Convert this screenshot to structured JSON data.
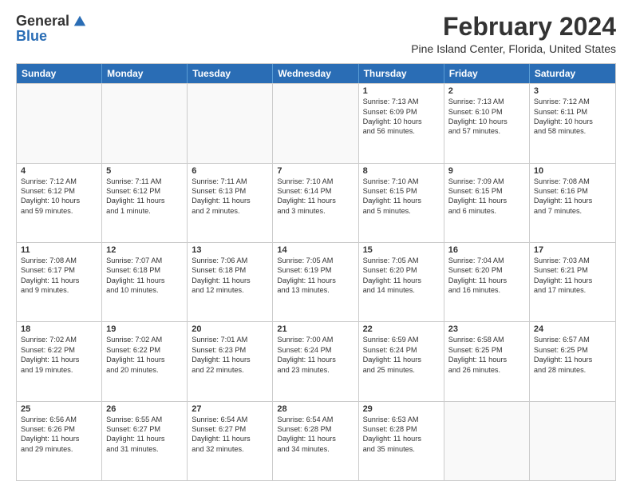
{
  "header": {
    "logo_general": "General",
    "logo_blue": "Blue",
    "month_title": "February 2024",
    "location": "Pine Island Center, Florida, United States"
  },
  "days_of_week": [
    "Sunday",
    "Monday",
    "Tuesday",
    "Wednesday",
    "Thursday",
    "Friday",
    "Saturday"
  ],
  "weeks": [
    [
      {
        "day": "",
        "empty": true
      },
      {
        "day": "",
        "empty": true
      },
      {
        "day": "",
        "empty": true
      },
      {
        "day": "",
        "empty": true
      },
      {
        "day": "1",
        "lines": [
          "Sunrise: 7:13 AM",
          "Sunset: 6:09 PM",
          "Daylight: 10 hours",
          "and 56 minutes."
        ]
      },
      {
        "day": "2",
        "lines": [
          "Sunrise: 7:13 AM",
          "Sunset: 6:10 PM",
          "Daylight: 10 hours",
          "and 57 minutes."
        ]
      },
      {
        "day": "3",
        "lines": [
          "Sunrise: 7:12 AM",
          "Sunset: 6:11 PM",
          "Daylight: 10 hours",
          "and 58 minutes."
        ]
      }
    ],
    [
      {
        "day": "4",
        "lines": [
          "Sunrise: 7:12 AM",
          "Sunset: 6:12 PM",
          "Daylight: 10 hours",
          "and 59 minutes."
        ]
      },
      {
        "day": "5",
        "lines": [
          "Sunrise: 7:11 AM",
          "Sunset: 6:12 PM",
          "Daylight: 11 hours",
          "and 1 minute."
        ]
      },
      {
        "day": "6",
        "lines": [
          "Sunrise: 7:11 AM",
          "Sunset: 6:13 PM",
          "Daylight: 11 hours",
          "and 2 minutes."
        ]
      },
      {
        "day": "7",
        "lines": [
          "Sunrise: 7:10 AM",
          "Sunset: 6:14 PM",
          "Daylight: 11 hours",
          "and 3 minutes."
        ]
      },
      {
        "day": "8",
        "lines": [
          "Sunrise: 7:10 AM",
          "Sunset: 6:15 PM",
          "Daylight: 11 hours",
          "and 5 minutes."
        ]
      },
      {
        "day": "9",
        "lines": [
          "Sunrise: 7:09 AM",
          "Sunset: 6:15 PM",
          "Daylight: 11 hours",
          "and 6 minutes."
        ]
      },
      {
        "day": "10",
        "lines": [
          "Sunrise: 7:08 AM",
          "Sunset: 6:16 PM",
          "Daylight: 11 hours",
          "and 7 minutes."
        ]
      }
    ],
    [
      {
        "day": "11",
        "lines": [
          "Sunrise: 7:08 AM",
          "Sunset: 6:17 PM",
          "Daylight: 11 hours",
          "and 9 minutes."
        ]
      },
      {
        "day": "12",
        "lines": [
          "Sunrise: 7:07 AM",
          "Sunset: 6:18 PM",
          "Daylight: 11 hours",
          "and 10 minutes."
        ]
      },
      {
        "day": "13",
        "lines": [
          "Sunrise: 7:06 AM",
          "Sunset: 6:18 PM",
          "Daylight: 11 hours",
          "and 12 minutes."
        ]
      },
      {
        "day": "14",
        "lines": [
          "Sunrise: 7:05 AM",
          "Sunset: 6:19 PM",
          "Daylight: 11 hours",
          "and 13 minutes."
        ]
      },
      {
        "day": "15",
        "lines": [
          "Sunrise: 7:05 AM",
          "Sunset: 6:20 PM",
          "Daylight: 11 hours",
          "and 14 minutes."
        ]
      },
      {
        "day": "16",
        "lines": [
          "Sunrise: 7:04 AM",
          "Sunset: 6:20 PM",
          "Daylight: 11 hours",
          "and 16 minutes."
        ]
      },
      {
        "day": "17",
        "lines": [
          "Sunrise: 7:03 AM",
          "Sunset: 6:21 PM",
          "Daylight: 11 hours",
          "and 17 minutes."
        ]
      }
    ],
    [
      {
        "day": "18",
        "lines": [
          "Sunrise: 7:02 AM",
          "Sunset: 6:22 PM",
          "Daylight: 11 hours",
          "and 19 minutes."
        ]
      },
      {
        "day": "19",
        "lines": [
          "Sunrise: 7:02 AM",
          "Sunset: 6:22 PM",
          "Daylight: 11 hours",
          "and 20 minutes."
        ]
      },
      {
        "day": "20",
        "lines": [
          "Sunrise: 7:01 AM",
          "Sunset: 6:23 PM",
          "Daylight: 11 hours",
          "and 22 minutes."
        ]
      },
      {
        "day": "21",
        "lines": [
          "Sunrise: 7:00 AM",
          "Sunset: 6:24 PM",
          "Daylight: 11 hours",
          "and 23 minutes."
        ]
      },
      {
        "day": "22",
        "lines": [
          "Sunrise: 6:59 AM",
          "Sunset: 6:24 PM",
          "Daylight: 11 hours",
          "and 25 minutes."
        ]
      },
      {
        "day": "23",
        "lines": [
          "Sunrise: 6:58 AM",
          "Sunset: 6:25 PM",
          "Daylight: 11 hours",
          "and 26 minutes."
        ]
      },
      {
        "day": "24",
        "lines": [
          "Sunrise: 6:57 AM",
          "Sunset: 6:25 PM",
          "Daylight: 11 hours",
          "and 28 minutes."
        ]
      }
    ],
    [
      {
        "day": "25",
        "lines": [
          "Sunrise: 6:56 AM",
          "Sunset: 6:26 PM",
          "Daylight: 11 hours",
          "and 29 minutes."
        ]
      },
      {
        "day": "26",
        "lines": [
          "Sunrise: 6:55 AM",
          "Sunset: 6:27 PM",
          "Daylight: 11 hours",
          "and 31 minutes."
        ]
      },
      {
        "day": "27",
        "lines": [
          "Sunrise: 6:54 AM",
          "Sunset: 6:27 PM",
          "Daylight: 11 hours",
          "and 32 minutes."
        ]
      },
      {
        "day": "28",
        "lines": [
          "Sunrise: 6:54 AM",
          "Sunset: 6:28 PM",
          "Daylight: 11 hours",
          "and 34 minutes."
        ]
      },
      {
        "day": "29",
        "lines": [
          "Sunrise: 6:53 AM",
          "Sunset: 6:28 PM",
          "Daylight: 11 hours",
          "and 35 minutes."
        ]
      },
      {
        "day": "",
        "empty": true
      },
      {
        "day": "",
        "empty": true
      }
    ]
  ]
}
